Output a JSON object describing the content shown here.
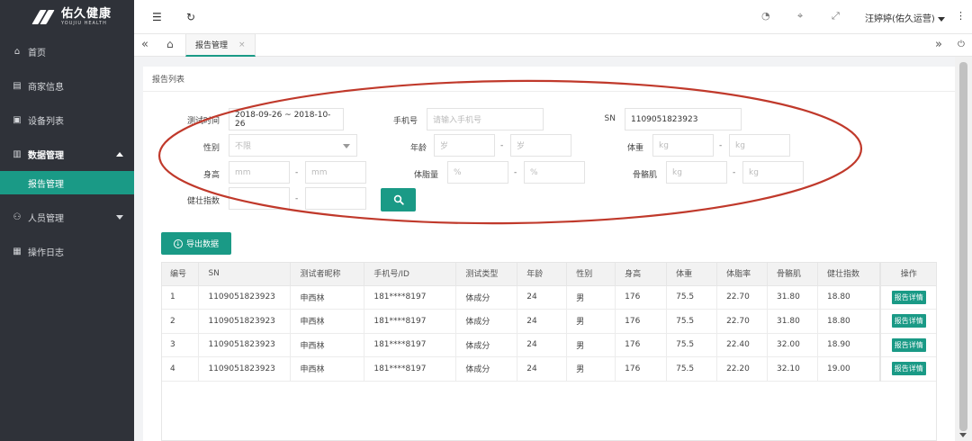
{
  "brand": {
    "name": "佑久健康",
    "name_en": "YOUJIU HEALTH"
  },
  "sidebar": {
    "items": [
      {
        "label": "首页",
        "icon": "home-icon"
      },
      {
        "label": "商家信息",
        "icon": "store-icon"
      },
      {
        "label": "设备列表",
        "icon": "device-icon"
      },
      {
        "label": "数据管理",
        "icon": "chart-icon",
        "expanded": true
      },
      {
        "label": "人员管理",
        "icon": "user-icon",
        "expanded": false
      },
      {
        "label": "操作日志",
        "icon": "log-icon"
      }
    ],
    "sub_item": "报告管理"
  },
  "topbar": {
    "user": "汪婷婷(佑久运营)",
    "icons": [
      "menu-toggle-icon",
      "refresh-icon",
      "dashboard-icon",
      "tag-icon",
      "fullscreen-icon",
      "more-icon"
    ]
  },
  "tabs": {
    "active": "报告管理",
    "close": "×"
  },
  "panel": {
    "title": "报告列表"
  },
  "filters": {
    "test_time": {
      "label": "测试时间",
      "value": "2018-09-26 ~ 2018-10-26"
    },
    "phone": {
      "label": "手机号",
      "placeholder": "请输入手机号"
    },
    "sn": {
      "label": "SN",
      "value": "1109051823923"
    },
    "gender": {
      "label": "性别",
      "placeholder": "不限"
    },
    "age": {
      "label": "年龄",
      "unit": "岁"
    },
    "weight": {
      "label": "体重",
      "unit": "kg"
    },
    "height": {
      "label": "身高",
      "unit": "mm"
    },
    "fat": {
      "label": "体脂量",
      "unit": "%"
    },
    "muscle": {
      "label": "骨骼肌",
      "unit": "kg"
    },
    "fitness": {
      "label": "健壮指数"
    },
    "dash": "-"
  },
  "export_label": "导出数据",
  "table": {
    "headers": [
      "编号",
      "SN",
      "测试者昵称",
      "手机号/ID",
      "测试类型",
      "年龄",
      "性别",
      "身高",
      "体重",
      "体脂率",
      "骨骼肌",
      "健壮指数",
      "操作"
    ],
    "rows": [
      [
        "1",
        "1109051823923",
        "申西林",
        "181****8197",
        "体成分",
        "24",
        "男",
        "176",
        "75.5",
        "22.70",
        "31.80",
        "18.80"
      ],
      [
        "2",
        "1109051823923",
        "申西林",
        "181****8197",
        "体成分",
        "24",
        "男",
        "176",
        "75.5",
        "22.70",
        "31.80",
        "18.80"
      ],
      [
        "3",
        "1109051823923",
        "申西林",
        "181****8197",
        "体成分",
        "24",
        "男",
        "176",
        "75.5",
        "22.40",
        "32.00",
        "18.90"
      ],
      [
        "4",
        "1109051823923",
        "申西林",
        "181****8197",
        "体成分",
        "24",
        "男",
        "176",
        "75.5",
        "22.20",
        "32.10",
        "19.00"
      ]
    ],
    "action_label": "报告详情"
  },
  "colors": {
    "accent": "#1a9a86",
    "sidebar_bg": "#2f3239",
    "annotation": "#c0392b"
  }
}
